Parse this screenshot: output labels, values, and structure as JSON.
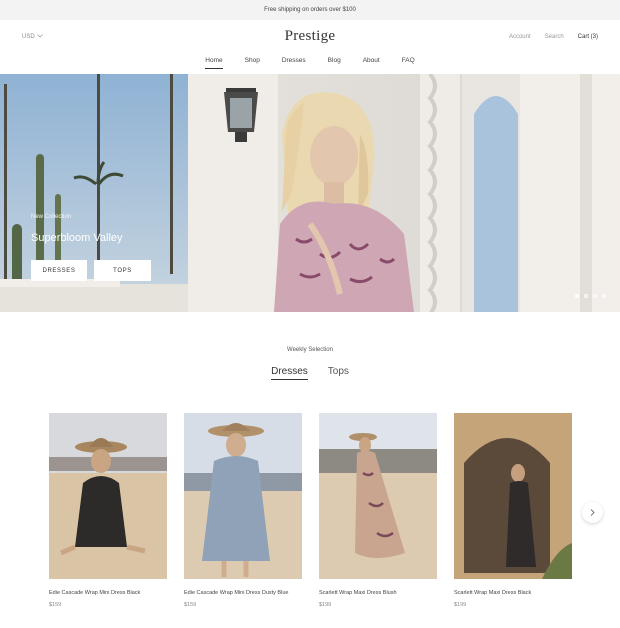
{
  "announcement": "Free shipping on orders over $100",
  "header": {
    "currency": "USD",
    "brand": "Prestige",
    "account": "Account",
    "search": "Search",
    "cart": "Cart (3)"
  },
  "nav": [
    "Home",
    "Shop",
    "Dresses",
    "Blog",
    "About",
    "FAQ"
  ],
  "hero": {
    "kicker": "New Collection",
    "title": "Superbloom Valley",
    "button_dresses": "DRESSES",
    "button_tops": "TOPS",
    "slides": 4,
    "active_slide": 1
  },
  "weekly": {
    "kicker": "Weekly Selection",
    "tabs": [
      "Dresses",
      "Tops"
    ],
    "active_tab": "Dresses"
  },
  "products": [
    {
      "name": "Edie Cascade Wrap Mini Dress Black",
      "price": "$159"
    },
    {
      "name": "Edie Cascade Wrap Mini Dress Dusty Blue",
      "price": "$159"
    },
    {
      "name": "Scarlett Wrap Maxi Dress Blush",
      "price": "$199"
    },
    {
      "name": "Scarlett Wrap Maxi Dress Black",
      "price": "$199"
    }
  ],
  "colors": {
    "accent": "#333333",
    "announcement_bg": "#f3f3f3",
    "muted": "#999999"
  }
}
